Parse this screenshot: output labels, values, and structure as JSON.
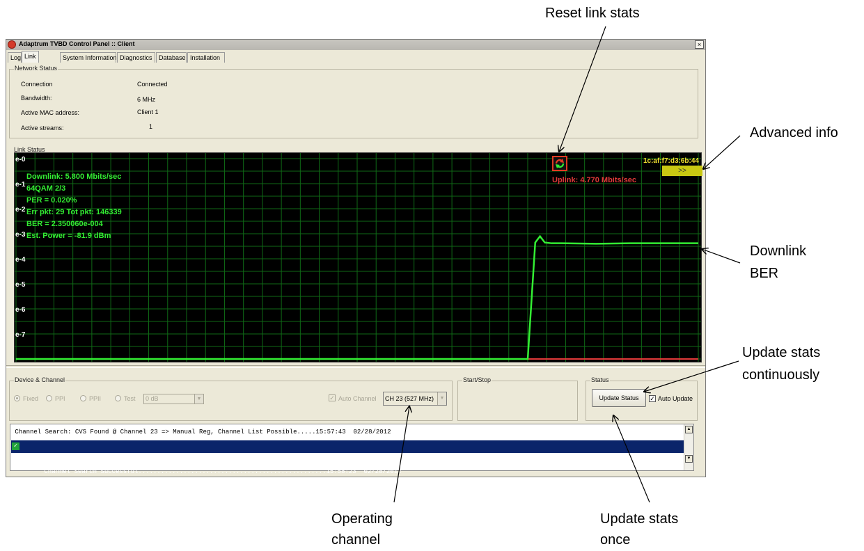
{
  "window": {
    "title": "Adaptrum TVBD Control Panel :: Client",
    "close_glyph": "×"
  },
  "tabs": [
    {
      "label": "Log",
      "active": false
    },
    {
      "label": "Link",
      "active": true
    },
    {
      "label": "System Information",
      "active": false
    },
    {
      "label": "Diagnostics",
      "active": false
    },
    {
      "label": "Database",
      "active": false
    },
    {
      "label": "Installation",
      "active": false
    }
  ],
  "network_status": {
    "title": "Network Status",
    "rows": [
      {
        "label": "Connection",
        "value": "Connected"
      },
      {
        "label": "Bandwidth:",
        "value": "6 MHz"
      },
      {
        "label": "Active MAC address:",
        "value": "Client 1"
      },
      {
        "label": "Active streams:",
        "value": "1"
      }
    ]
  },
  "link_status": {
    "title": "Link Status",
    "downlink_lines": [
      "Downlink:  5.800 Mbits/sec",
      "64QAM  2/3",
      "PER = 0.020%",
      "Err pkt: 29 Tot pkt: 146339",
      "BER = 2.350060e-004",
      "Est. Power = -81.9 dBm"
    ],
    "uplink_text": "Uplink: 4.770 Mbits/sec",
    "mac_text": "1c:af:f7:d3:6b:44",
    "advanced_button_label": ">>",
    "reset_icon": "reset-arrows-icon",
    "colors": {
      "downlink": "#33ee33",
      "uplink": "#e23a3a",
      "grid": "#0f6a16",
      "mac": "#f2e030"
    }
  },
  "chart_data": {
    "type": "line",
    "y_tick_labels": [
      "e-0",
      "e-1",
      "e-2",
      "e-3",
      "e-4",
      "e-5",
      "e-6",
      "e-7"
    ],
    "y_scale": "log",
    "ylim": [
      -8,
      0
    ],
    "grid": true,
    "series": [
      {
        "name": "Downlink",
        "color": "#33ee33",
        "x": [
          0,
          5,
          10,
          15,
          20,
          25,
          30,
          35,
          40,
          45,
          50,
          55,
          60,
          65,
          70,
          75,
          76.1,
          76.8,
          77.5,
          78.5,
          80,
          85,
          90,
          95,
          100
        ],
        "y": [
          -8.0,
          -8.0,
          -8.0,
          -8.0,
          -8.0,
          -8.0,
          -8.0,
          -8.0,
          -8.0,
          -8.0,
          -8.0,
          -8.0,
          -8.0,
          -8.0,
          -8.0,
          -8.0,
          -3.35,
          -3.1,
          -3.35,
          -3.38,
          -3.38,
          -3.4,
          -3.38,
          -3.38,
          -3.38
        ]
      },
      {
        "name": "Uplink",
        "color": "#e23a3a",
        "x": [
          0,
          100
        ],
        "y": [
          -8.0,
          -8.0
        ]
      }
    ]
  },
  "device_channel": {
    "title": "Device & Channel",
    "modes": [
      {
        "label": "Fixed",
        "checked": true
      },
      {
        "label": "PPI",
        "checked": false
      },
      {
        "label": "PPII",
        "checked": false
      },
      {
        "label": "Test",
        "checked": false
      }
    ],
    "test_value": "0 dB",
    "auto_channel_label": "Auto Channel",
    "auto_channel_checked": true,
    "channel_value": "CH 23 (527 MHz)"
  },
  "start_stop": {
    "title": "Start/Stop"
  },
  "status": {
    "title": "Status",
    "update_button_label": "Update Status",
    "auto_update_label": "Auto Update",
    "auto_update_checked": true
  },
  "log": {
    "rows": [
      {
        "text": " Channel Search: CVS Found @ Channel 23 => Manual Reg, Channel List Possible.....15:57:43  02/28/2012",
        "selected": false,
        "icon": ""
      },
      {
        "text": "Channel Search Successful..................................................15:58:23  02/28/2012",
        "selected": true,
        "icon": "green-check-icon"
      }
    ]
  },
  "annotations": {
    "reset": "Reset link stats",
    "advanced": "Advanced info",
    "downlink_ber_1": "Downlink",
    "downlink_ber_2": "BER",
    "update_cont_1": "Update stats",
    "update_cont_2": "continuously",
    "operating_1": "Operating",
    "operating_2": "channel",
    "update_once_1": "Update stats",
    "update_once_2": "once"
  }
}
